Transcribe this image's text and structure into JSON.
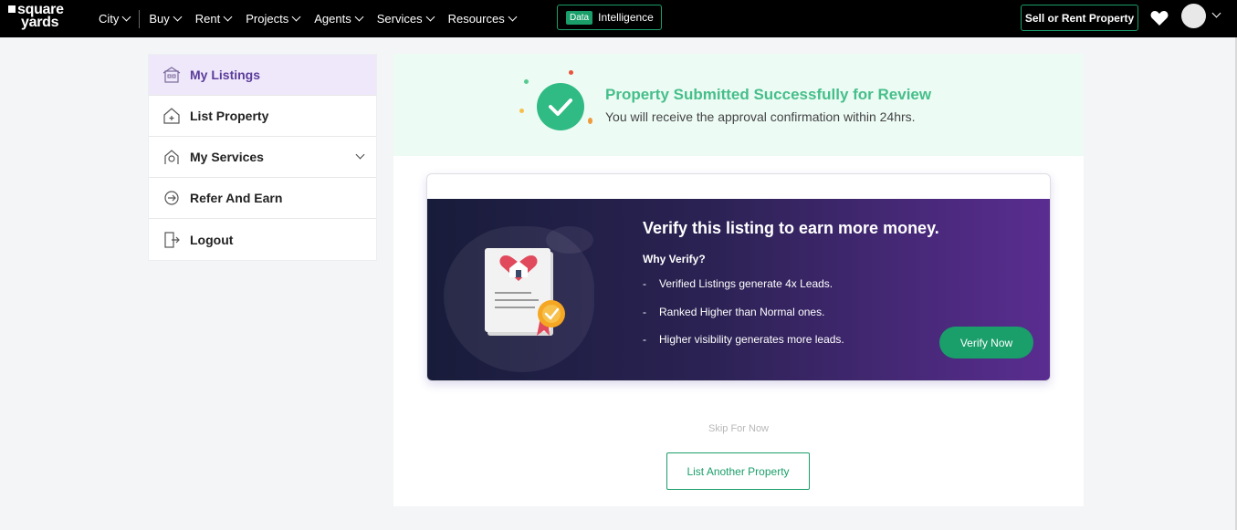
{
  "header": {
    "logo_line1": "square",
    "logo_line2": "yards",
    "nav": [
      {
        "label": "City"
      },
      {
        "label": "Buy"
      },
      {
        "label": "Rent"
      },
      {
        "label": "Projects"
      },
      {
        "label": "Agents"
      },
      {
        "label": "Services"
      },
      {
        "label": "Resources"
      }
    ],
    "data_intel_tag": "Data",
    "data_intel_label": "Intelligence",
    "sell_rent_label": "Sell or Rent Property",
    "icons": [
      "heart-icon",
      "avatar",
      "chevron-down-icon"
    ]
  },
  "sidebar": {
    "items": [
      {
        "label": "My Listings",
        "icon": "listings-icon"
      },
      {
        "label": "List Property",
        "icon": "house-add-icon"
      },
      {
        "label": "My Services",
        "icon": "services-icon"
      },
      {
        "label": "Refer And Earn",
        "icon": "refer-icon"
      },
      {
        "label": "Logout",
        "icon": "logout-icon"
      }
    ]
  },
  "success": {
    "title": "Property Submitted Successfully for Review",
    "subtitle": "You will receive the approval confirmation within 24hrs."
  },
  "verify": {
    "title": "Verify this listing to earn more money.",
    "why": "Why Verify?",
    "points": [
      "Verified Listings generate 4x Leads.",
      "Ranked Higher than Normal ones.",
      "Higher visibility generates more leads."
    ],
    "button": "Verify Now"
  },
  "actions": {
    "skip": "Skip For Now",
    "list_another": "List Another Property"
  },
  "colors": {
    "brand_green": "#1a9e6a",
    "success_green": "#45bf89",
    "active_purple": "#5b3c9a",
    "header_bg": "#000000"
  }
}
